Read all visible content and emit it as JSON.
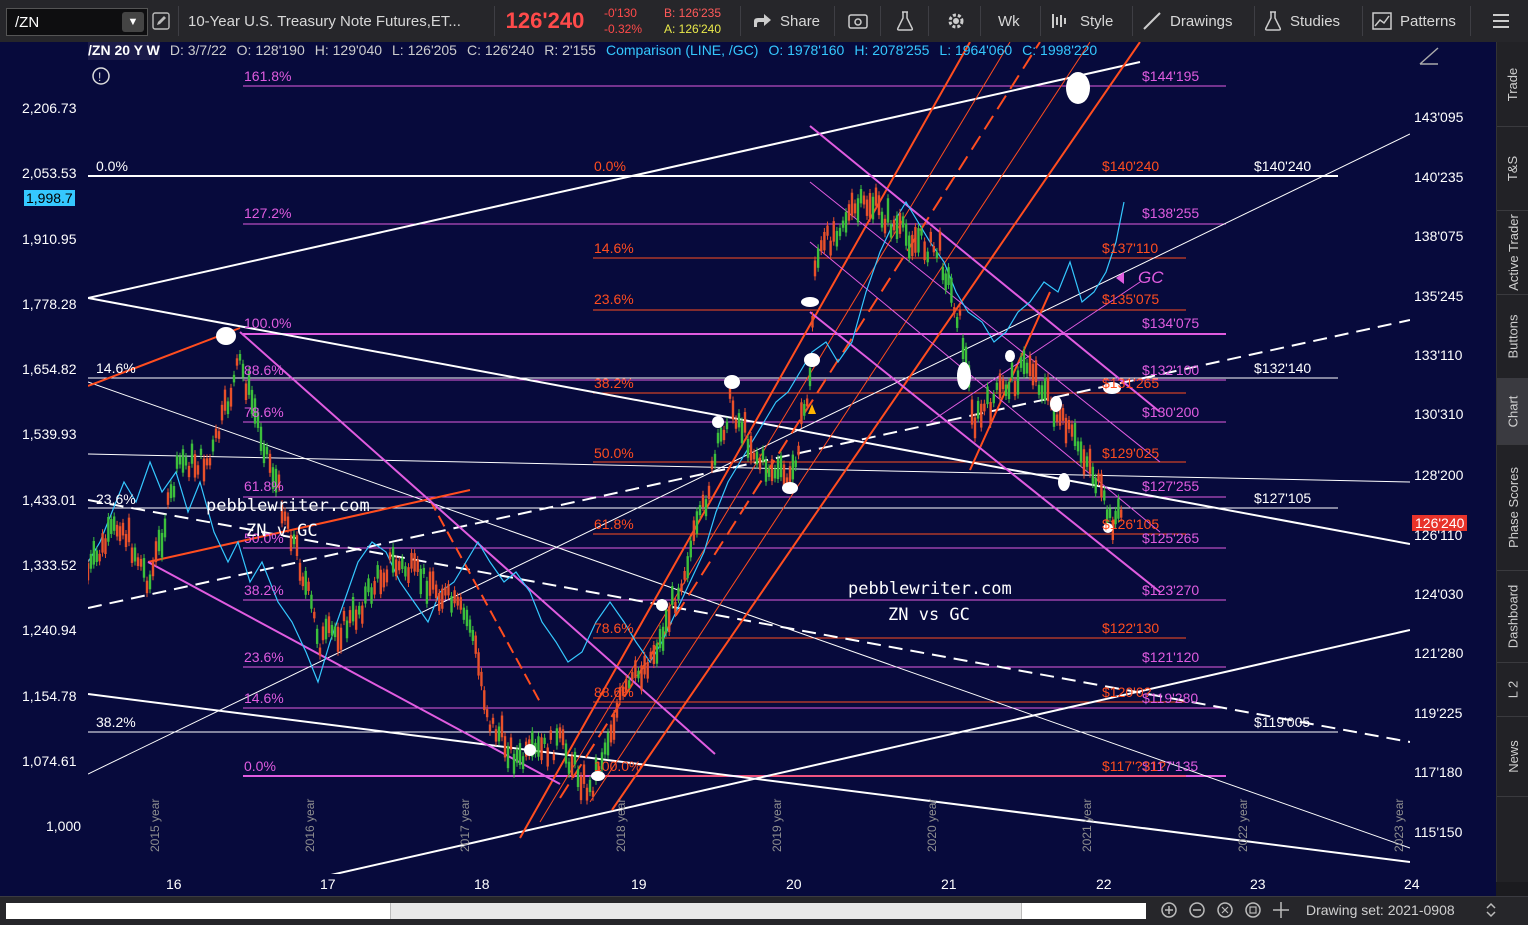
{
  "toolbar": {
    "symbol": "/ZN",
    "symbol_dropdown": "▼",
    "description": "10-Year U.S. Treasury Note Futures,ET...",
    "last_price": "126'240",
    "net_change": "-0'130",
    "pct_change": "-0.32%",
    "bid": "B: 126'235",
    "ask": "A: 126'240",
    "share_label": "Share",
    "period_label": "Wk",
    "style_label": "Style",
    "drawings_label": "Drawings",
    "studies_label": "Studies",
    "patterns_label": "Patterns"
  },
  "info": {
    "symbol_period": "/ZN 20 Y W",
    "date": "D: 3/7/22",
    "open": "O: 128'190",
    "high": "H: 129'040",
    "low": "L: 126'205",
    "close": "C: 126'240",
    "range": "R: 2'155",
    "comparison_label": "Comparison (LINE, /GC)",
    "cmp_open": "O: 1978'160",
    "cmp_high": "H: 2078'255",
    "cmp_low": "L: 1964'060",
    "cmp_close": "C: 1998'220"
  },
  "colors": {
    "chart_bg": "#070a3c",
    "magenta": "#e05ce0",
    "orange": "#ff4d1f",
    "white": "#ffffff",
    "cyan": "#35c8ff",
    "candle_up": "#3cbf3c",
    "candle_down": "#e8502a"
  },
  "left_axis": [
    "2,206.73",
    "2,053.53",
    "1,998.7",
    "1,910.95",
    "1,778.28",
    "1,654.82",
    "1,539.93",
    "1,433.01",
    "1,333.52",
    "1,240.94",
    "1,154.78",
    "1,074.61",
    "1,000"
  ],
  "right_axis": [
    "143'095",
    "140'235",
    "138'075",
    "135'245",
    "133'110",
    "130'310",
    "128'200",
    "126'240",
    "126'110",
    "124'030",
    "121'280",
    "119'225",
    "117'180",
    "115'150"
  ],
  "x_axis": [
    "16",
    "17",
    "18",
    "19",
    "20",
    "21",
    "22",
    "23",
    "24"
  ],
  "year_labels": [
    "2015 year",
    "2016 year",
    "2017 year",
    "2018 year",
    "2019 year",
    "2020 year",
    "2021 year",
    "2022 year",
    "2023 year"
  ],
  "fib_left": [
    "161.8%",
    "127.2%",
    "100.0%",
    "88.6%",
    "78.6%",
    "61.8%",
    "50.0%",
    "38.2%",
    "23.6%",
    "14.6%",
    "0.0%"
  ],
  "fib_mid": [
    "0.0%",
    "14.6%",
    "23.6%",
    "38.2%",
    "50.0%",
    "61.8%",
    "78.6%",
    "88.6%",
    "100.0%"
  ],
  "fib_white_left": [
    "0.0%",
    "14.6%",
    "23.6%",
    "38.2%"
  ],
  "price_labels_magenta": [
    "$144'195",
    "$138'255",
    "$134'075",
    "$132'100",
    "$130'200",
    "$127'255",
    "$125'265",
    "$123'270",
    "$121'120",
    "$119'280",
    "$117'135"
  ],
  "price_labels_orange": [
    "$140'240",
    "$137'110",
    "$135'075",
    "$131'265",
    "$129'025",
    "$126'105",
    "$122'130",
    "$120'0?",
    "$117'?31?"
  ],
  "price_labels_white": [
    "$140'240",
    "$132'140",
    "$127'105",
    "$119'005"
  ],
  "gc_label": "GC",
  "watermark": "pebblewriter.com",
  "watermark_sub": "ZN v GC",
  "watermark_sub2": "ZN vs GC",
  "side_tabs": [
    "Trade",
    "T&S",
    "Active Trader",
    "Buttons",
    "Chart",
    "Phase Scores",
    "Dashboard",
    "L 2",
    "News"
  ],
  "drawing_set": "Drawing set: 2021-0908"
}
